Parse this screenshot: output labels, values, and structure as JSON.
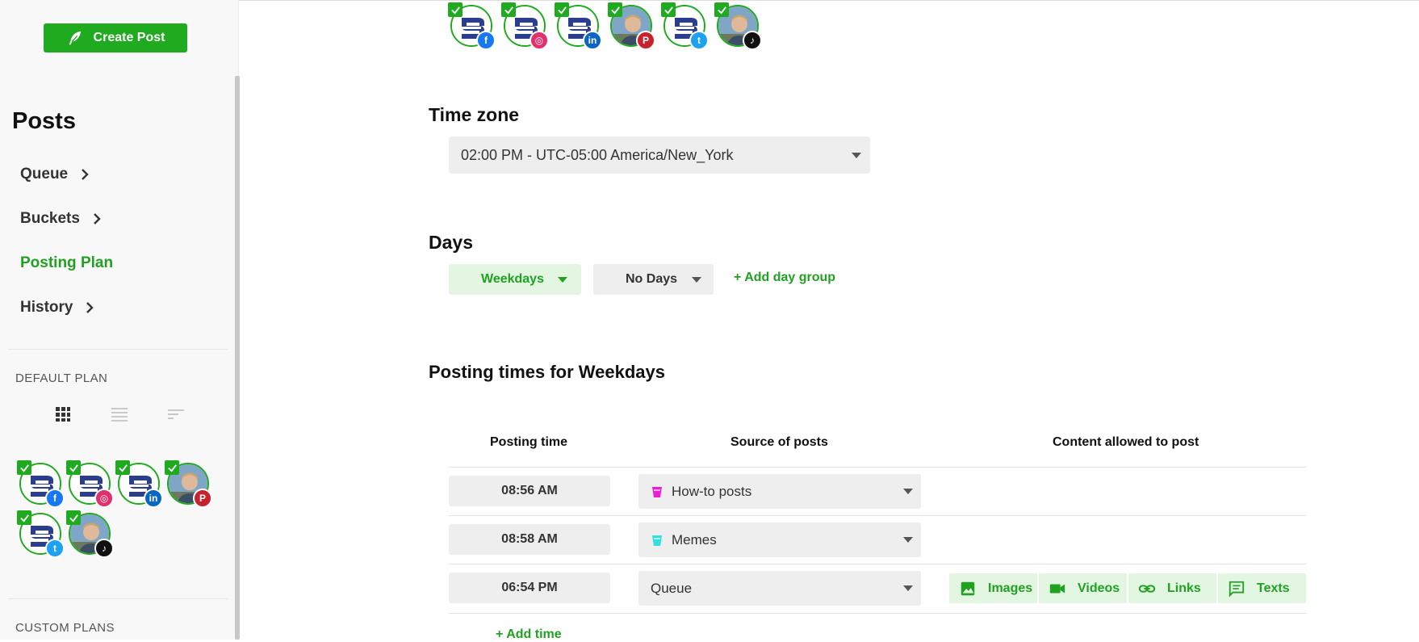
{
  "sidebar": {
    "create_label": "Create Post",
    "title": "Posts",
    "nav": [
      {
        "label": "Queue",
        "chevron": true
      },
      {
        "label": "Buckets",
        "chevron": true
      },
      {
        "label": "Posting Plan",
        "chevron": false,
        "active": true
      },
      {
        "label": "History",
        "chevron": true
      }
    ],
    "default_plan_label": "DEFAULT PLAN",
    "custom_plans_label": "CUSTOM PLANS",
    "view_modes": [
      "grid-view-icon",
      "list-view-icon",
      "compact-list-icon"
    ]
  },
  "accounts": [
    {
      "avatar": "brand-logo",
      "network": "facebook"
    },
    {
      "avatar": "brand-logo",
      "network": "instagram"
    },
    {
      "avatar": "brand-logo",
      "network": "linkedin"
    },
    {
      "avatar": "person-photo",
      "network": "pinterest"
    },
    {
      "avatar": "brand-logo",
      "network": "twitter"
    },
    {
      "avatar": "person-photo",
      "network": "tiktok"
    }
  ],
  "timezone": {
    "heading": "Time zone",
    "value": "02:00 PM - UTC-05:00 America/New_York"
  },
  "days": {
    "heading": "Days",
    "groups": [
      "Weekdays",
      "No Days"
    ],
    "add_label": "+ Add day group"
  },
  "posting_times": {
    "heading": "Posting times for Weekdays",
    "columns": [
      "Posting time",
      "Source of posts",
      "Content allowed to post"
    ],
    "rows": [
      {
        "time": "08:56 AM",
        "source": "How-to posts",
        "bucket_color": "#e81fd6"
      },
      {
        "time": "08:58 AM",
        "source": "Memes",
        "bucket_color": "#2ee0e6"
      },
      {
        "time": "06:54 PM",
        "source": "Queue",
        "bucket_color": null
      }
    ],
    "content_types": [
      "Images",
      "Videos",
      "Links",
      "Texts"
    ],
    "add_time_label": "+ Add time"
  },
  "colors": {
    "accent": "#1faa1f",
    "facebook": "#1877f2",
    "instagram": "#e1306c",
    "linkedin": "#0a66c2",
    "pinterest": "#c8232c",
    "twitter": "#1da1f2",
    "tiktok": "#111111"
  }
}
